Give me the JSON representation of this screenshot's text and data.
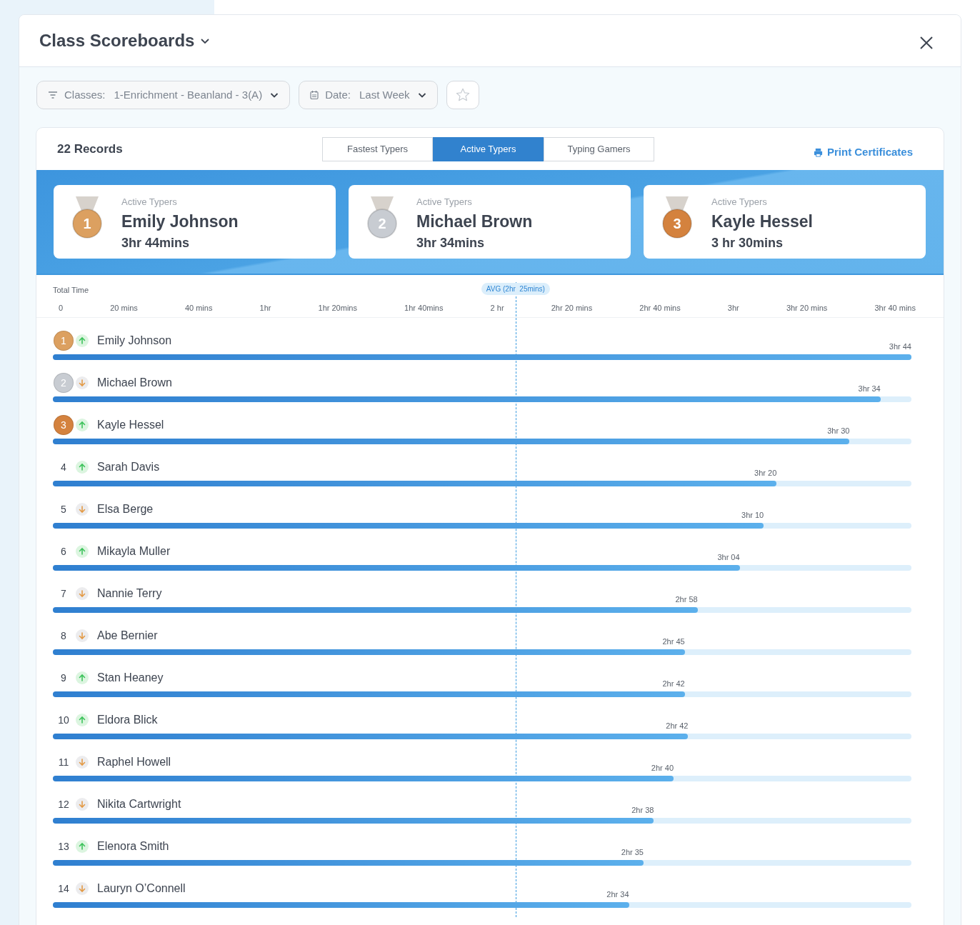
{
  "title": "Class Scoreboards",
  "filters": [
    {
      "kind": "classes",
      "label": "Classes:",
      "value": "1-Enrichment - Beanland - 3(A)"
    },
    {
      "kind": "date",
      "label": "Date:",
      "value": "Last Week"
    }
  ],
  "records": "22 Records",
  "tabs": [
    {
      "label": "Fastest Typers",
      "selected": false
    },
    {
      "label": "Active Typers",
      "selected": true
    },
    {
      "label": "Typing Gamers",
      "selected": false
    }
  ],
  "print_button": "Print Certificates",
  "podium": [
    {
      "rank": "1",
      "color": "#dca060",
      "caption": "Active Typers",
      "name": "Emily Johnson",
      "time": "3hr 44mins"
    },
    {
      "rank": "2",
      "color": "#c8ccd2",
      "caption": "Active Typers",
      "name": "Michael Brown",
      "time": "3hr 34mins"
    },
    {
      "rank": "3",
      "color": "#d4823e",
      "caption": "Active Typers",
      "name": "Kayle Hessel",
      "time": "3 hr 30mins"
    }
  ],
  "axis": {
    "title": "Total Time",
    "ticks": [
      "0",
      "20 mins",
      "40 mins",
      "1hr",
      "1hr 20mins",
      "1hr 40mins",
      "2 hr",
      "2hr 20 mins",
      "2hr 40 mins",
      "3hr",
      "3hr 20 mins",
      "3hr 40 mins"
    ]
  },
  "avg": {
    "label": "AVG (2hr  25mins)",
    "level": 0.539
  },
  "rows": [
    {
      "rank": "1",
      "color": "#dca060",
      "rising": true,
      "name": "Emily Johnson",
      "value": "3hr 44",
      "level": 1.0
    },
    {
      "rank": "2",
      "color": "#c8ccd2",
      "rising": false,
      "name": "Michael Brown",
      "value": "3hr 34",
      "level": 0.964
    },
    {
      "rank": "3",
      "color": "#d4823e",
      "rising": true,
      "name": "Kayle Hessel",
      "value": "3hr 30",
      "level": 0.928
    },
    {
      "rank": "4",
      "rising": true,
      "name": "Sarah Davis",
      "value": "3hr 20",
      "level": 0.843
    },
    {
      "rank": "5",
      "rising": false,
      "name": "Elsa Berge",
      "value": "3hr 10",
      "level": 0.828
    },
    {
      "rank": "6",
      "rising": true,
      "name": "Mikayla Muller",
      "value": "3hr 04",
      "level": 0.8
    },
    {
      "rank": "7",
      "rising": false,
      "name": "Nannie Terry",
      "value": "2hr 58",
      "level": 0.751
    },
    {
      "rank": "8",
      "rising": false,
      "name": "Abe Bernier",
      "value": "2hr 45",
      "level": 0.736
    },
    {
      "rank": "9",
      "rising": true,
      "name": "Stan Heaney",
      "value": "2hr 42",
      "level": 0.736
    },
    {
      "rank": "10",
      "rising": true,
      "name": "Eldora Blick",
      "value": "2hr 42",
      "level": 0.74
    },
    {
      "rank": "11",
      "rising": false,
      "name": "Raphel Howell",
      "value": "2hr 40",
      "level": 0.723
    },
    {
      "rank": "12",
      "rising": false,
      "name": "Nikita Cartwright",
      "value": "2hr 38",
      "level": 0.7
    },
    {
      "rank": "13",
      "rising": true,
      "name": "Elenora Smith",
      "value": "2hr 35",
      "level": 0.688
    },
    {
      "rank": "14",
      "rising": false,
      "name": "Lauryn O’Connell",
      "value": "2hr 34",
      "level": 0.671
    }
  ]
}
